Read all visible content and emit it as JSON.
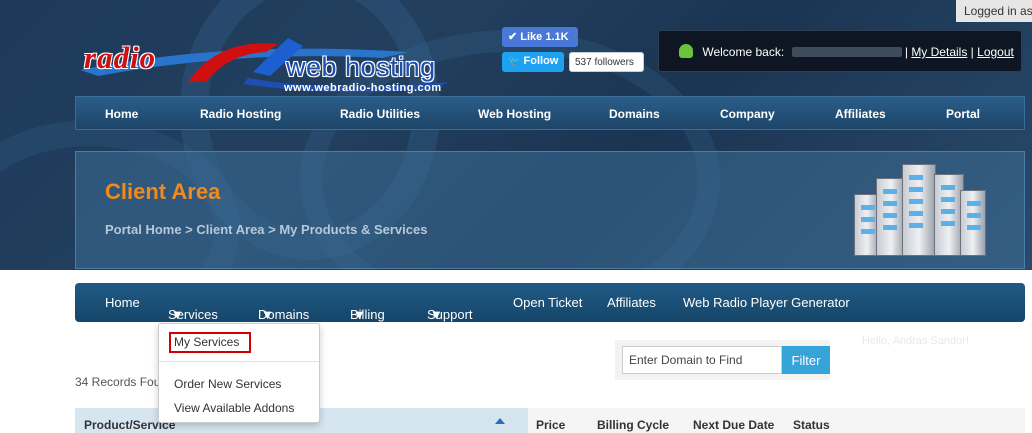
{
  "top_bar": {
    "logged_in_text": "Logged in as"
  },
  "logo": {
    "word1": "radio",
    "word2": "web hosting",
    "url": "www.webradio-hosting.com"
  },
  "social": {
    "like_label": "Like 1.1K",
    "follow_label": "Follow",
    "followers_count": "537 followers"
  },
  "welcome": {
    "text": "Welcome back:",
    "my_details": "My Details",
    "logout": "Logout",
    "separator": "|"
  },
  "main_nav": [
    "Home",
    "Radio Hosting",
    "Radio Utilities",
    "Web Hosting",
    "Domains",
    "Company",
    "Affiliates",
    "Portal"
  ],
  "banner": {
    "title": "Client Area",
    "breadcrumb": "Portal Home > Client Area > My Products & Services"
  },
  "secondary_nav": {
    "home": "Home",
    "services": "Services",
    "domains": "Domains",
    "billing": "Billing",
    "support": "Support",
    "open_ticket": "Open Ticket",
    "affiliates": "Affiliates",
    "player_generator": "Web Radio Player Generator"
  },
  "hello_text": "Hello, Andras Sandor!",
  "dropdown": {
    "my_services": "My Services",
    "order_new": "Order New Services",
    "view_addons": "View Available Addons"
  },
  "records_text": "34 Records Found",
  "search": {
    "placeholder": "Enter Domain to Find",
    "button": "Filter"
  },
  "table": {
    "headers": [
      "Product/Service",
      "Price",
      "Billing Cycle",
      "Next Due Date",
      "Status"
    ]
  },
  "colors": {
    "accent_orange": "#f08a1c",
    "nav_blue": "#1f5a86",
    "filter_blue": "#36a3d9",
    "highlight_red": "#d40000"
  }
}
